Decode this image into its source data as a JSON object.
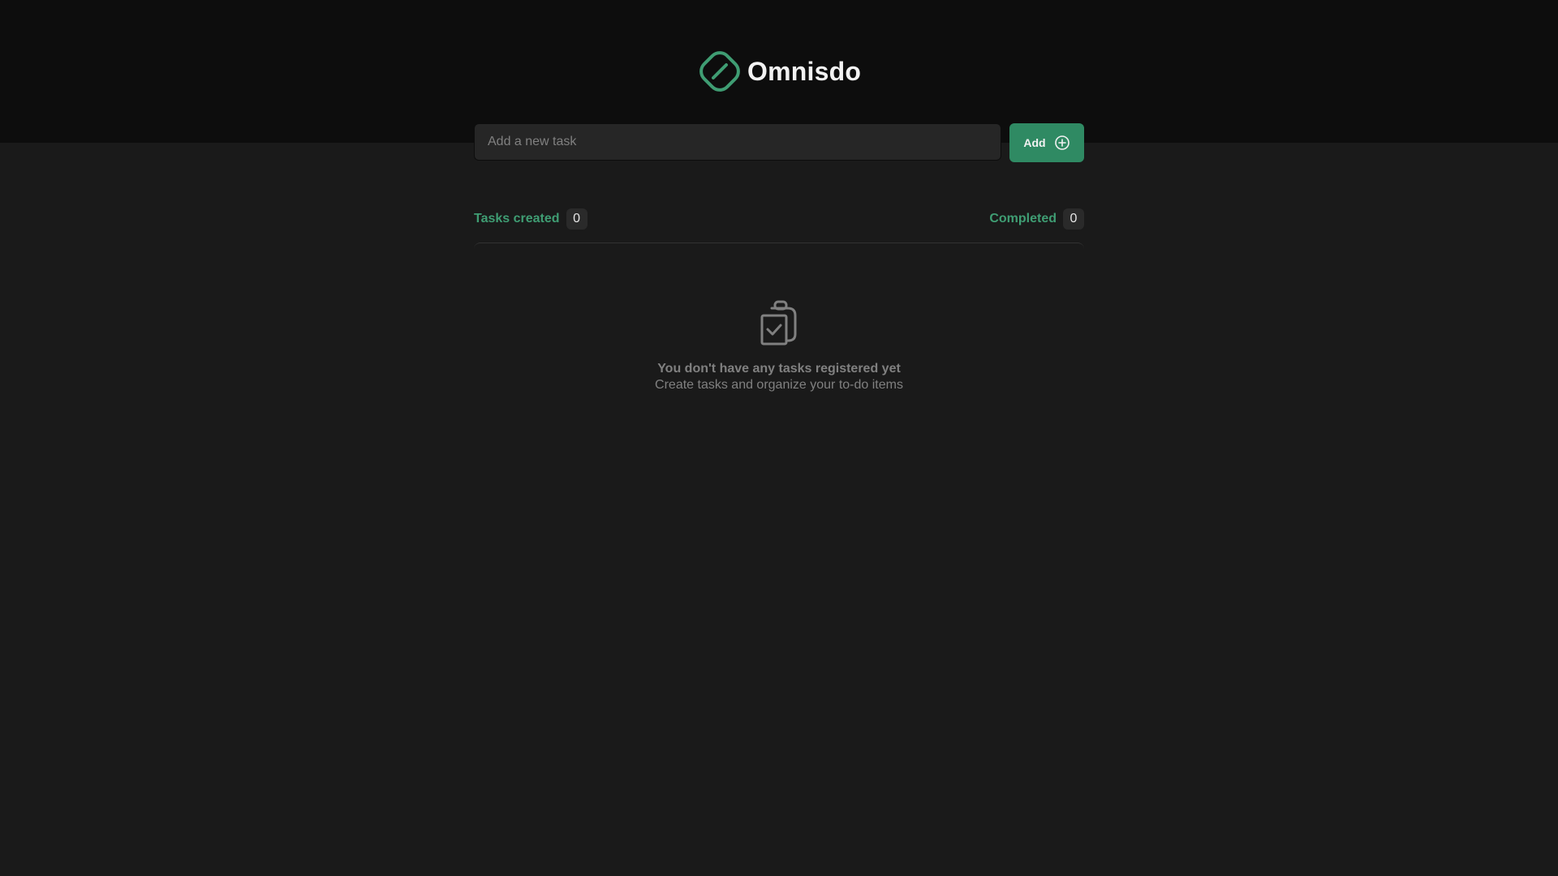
{
  "app": {
    "name": "Omnisdo",
    "logo_icon": "omnisdo-logo-icon",
    "accent_color": "#2f8a63",
    "accent_text_color": "#3f9d73",
    "background_color": "#1a1a1a",
    "header_color": "#0d0d0d"
  },
  "form": {
    "placeholder": "Add a new task",
    "value": "",
    "add_label": "Add",
    "add_icon": "plus-circle-icon"
  },
  "stats": {
    "created_label": "Tasks created",
    "created_count": "0",
    "completed_label": "Completed",
    "completed_count": "0"
  },
  "empty_state": {
    "icon": "clipboard-check-icon",
    "title": "You don't have any tasks registered yet",
    "subtitle": "Create tasks and organize your to-do items"
  }
}
